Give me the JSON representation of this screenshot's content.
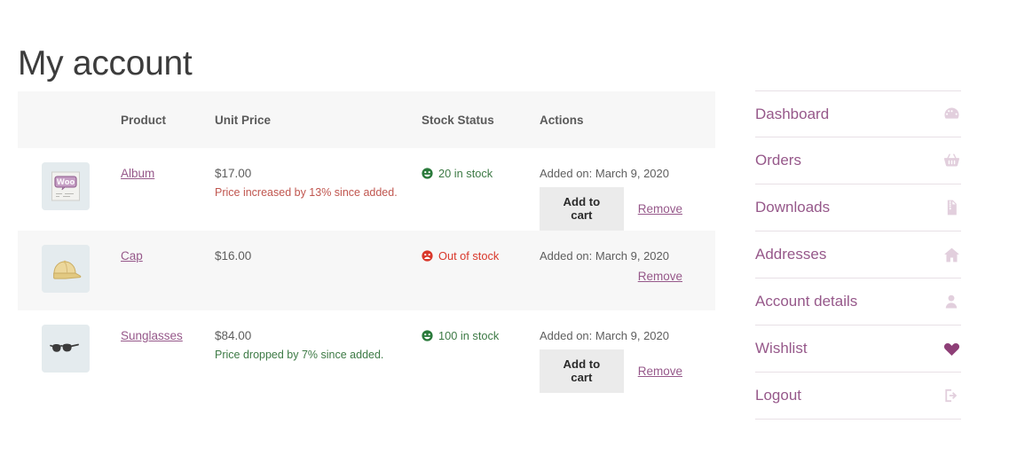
{
  "page": {
    "title": "My account"
  },
  "wishlist": {
    "columns": [
      "",
      "Product",
      "Unit Price",
      "Stock Status",
      "Actions"
    ],
    "add_to_cart_label": "Add to cart",
    "remove_label": "Remove",
    "rows": [
      {
        "thumb_icon": "album-thumbnail",
        "name": "Album",
        "price": "$17.00",
        "price_note": "Price increased by 13% since added.",
        "price_note_dir": "up",
        "stock_status": "20 in stock",
        "stock_state": "in",
        "added_on": "Added on: March 9, 2020",
        "has_add_to_cart": true
      },
      {
        "thumb_icon": "cap-thumbnail",
        "name": "Cap",
        "price": "$16.00",
        "price_note": "",
        "price_note_dir": "",
        "stock_status": "Out of stock",
        "stock_state": "out",
        "added_on": "Added on: March 9, 2020",
        "has_add_to_cart": false
      },
      {
        "thumb_icon": "sunglasses-thumbnail",
        "name": "Sunglasses",
        "price": "$84.00",
        "price_note": "Price dropped by 7% since added.",
        "price_note_dir": "down",
        "stock_status": "100 in stock",
        "stock_state": "in",
        "added_on": "Added on: March 9, 2020",
        "has_add_to_cart": true
      }
    ]
  },
  "sidebar": {
    "items": [
      {
        "label": "Dashboard",
        "icon": "dashboard-gauge-icon",
        "active": false
      },
      {
        "label": "Orders",
        "icon": "shopping-basket-icon",
        "active": false
      },
      {
        "label": "Downloads",
        "icon": "download-file-icon",
        "active": false
      },
      {
        "label": "Addresses",
        "icon": "home-icon",
        "active": false
      },
      {
        "label": "Account details",
        "icon": "person-icon",
        "active": false
      },
      {
        "label": "Wishlist",
        "icon": "heart-icon",
        "active": true
      },
      {
        "label": "Logout",
        "icon": "logout-arrow-icon",
        "active": false
      }
    ]
  },
  "colors": {
    "link": "#96588a",
    "in_stock": "#3d7a45",
    "out_of_stock": "#d9382b",
    "price_up": "#c0564f",
    "price_down": "#3d7a45",
    "header_bg": "#f7f7f7",
    "button_bg": "#ebebeb"
  }
}
